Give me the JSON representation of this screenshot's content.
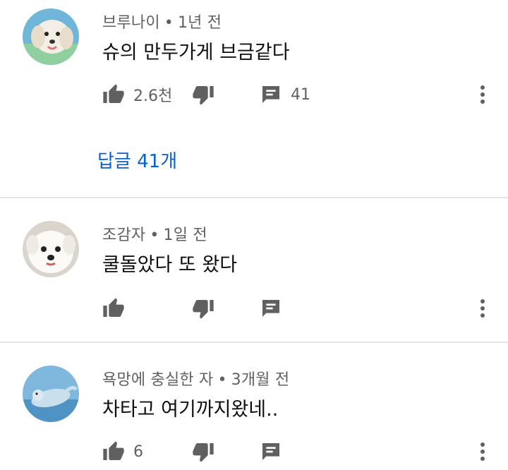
{
  "comments": [
    {
      "author": "브루나이",
      "time": "1년 전",
      "text": "슈의 만두가게 브금같다",
      "likes": "2.6천",
      "replies_count": "41",
      "replies_link": "답글 41개",
      "avatar_icon": "puppy-avatar-icon"
    },
    {
      "author": "조감자",
      "time": "1일 전",
      "text": "쿨돌았다 또 왔다",
      "likes": "",
      "replies_count": "",
      "avatar_icon": "white-dog-avatar-icon"
    },
    {
      "author": "욕망에 충실한 자",
      "time": "3개월 전",
      "text": "차타고 여기까지왔네..",
      "likes": "6",
      "replies_count": "",
      "avatar_icon": "seal-avatar-icon"
    }
  ],
  "separator": "•",
  "colors": {
    "icon_gray": "#606060",
    "link_blue": "#065fd4",
    "divider": "#e5e5e5"
  }
}
